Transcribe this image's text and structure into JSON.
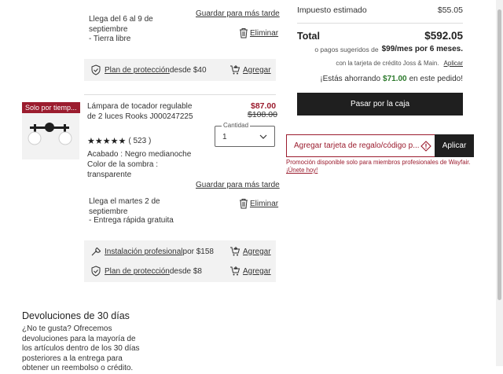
{
  "item1": {
    "delivery": "Llega del 6 al 9 de septiembre",
    "shipping": "- Tierra libre",
    "save_later": "Guardar para más tarde",
    "remove": "Eliminar",
    "protection": {
      "link": "Plan de protección",
      "price": "desde $40",
      "add": "Agregar"
    }
  },
  "item2": {
    "badge": "Solo por tiemp...",
    "title": "Lámpara de tocador regulable de 2 luces Rooks J000247225",
    "price": "$87.00",
    "old_price": "$108.00",
    "rating_count": "( 523 )",
    "rating": 5,
    "quantity_label": "Cantidad",
    "quantity": "1",
    "finish": "Acabado : Negro medianoche",
    "shade": "Color de la sombra : transparente",
    "save_later": "Guardar para más tarde",
    "delivery": "Llega el martes 2 de septiembre",
    "shipping": "- Entrega rápida gratuita",
    "remove": "Eliminar",
    "install": {
      "link": "Instalación profesional",
      "price": "por $158",
      "add": "Agregar"
    },
    "protection": {
      "link": "Plan de protección",
      "price": "desde $8",
      "add": "Agregar"
    }
  },
  "returns": {
    "title": "Devoluciones de 30 días",
    "text": "¿No te gusta? Ofrecemos devoluciones para la mayoría de los artículos dentro de los 30 días posteriores a la entrega para obtener un reembolso o crédito."
  },
  "summary": {
    "tax_label": "Impuesto estimado",
    "tax_value": "$55.05",
    "total_label": "Total",
    "total_value": "$592.05",
    "financing_prefix": "o pagos sugeridos de",
    "financing_amount": "$99/mes por 6 meses.",
    "card_text": "con la tarjeta de crédito Joss & Main.",
    "apply": "Aplicar",
    "savings_prefix": "¡Estás ahorrando",
    "savings_amount": "$71.00",
    "savings_suffix": "en este pedido!",
    "checkout": "Pasar por la caja",
    "promo_placeholder": "Agregar tarjeta de regalo/código p...",
    "promo_apply": "Aplicar",
    "promo_warning": "Promoción disponible solo para miembros profesionales de Wayfair.",
    "join_link": "¡Únete hoy!"
  },
  "colors": {
    "accent_red": "#9b1c2e",
    "sale_red": "#9b1c2e",
    "green": "#2d7a2d",
    "dark": "#1f1f1f"
  }
}
